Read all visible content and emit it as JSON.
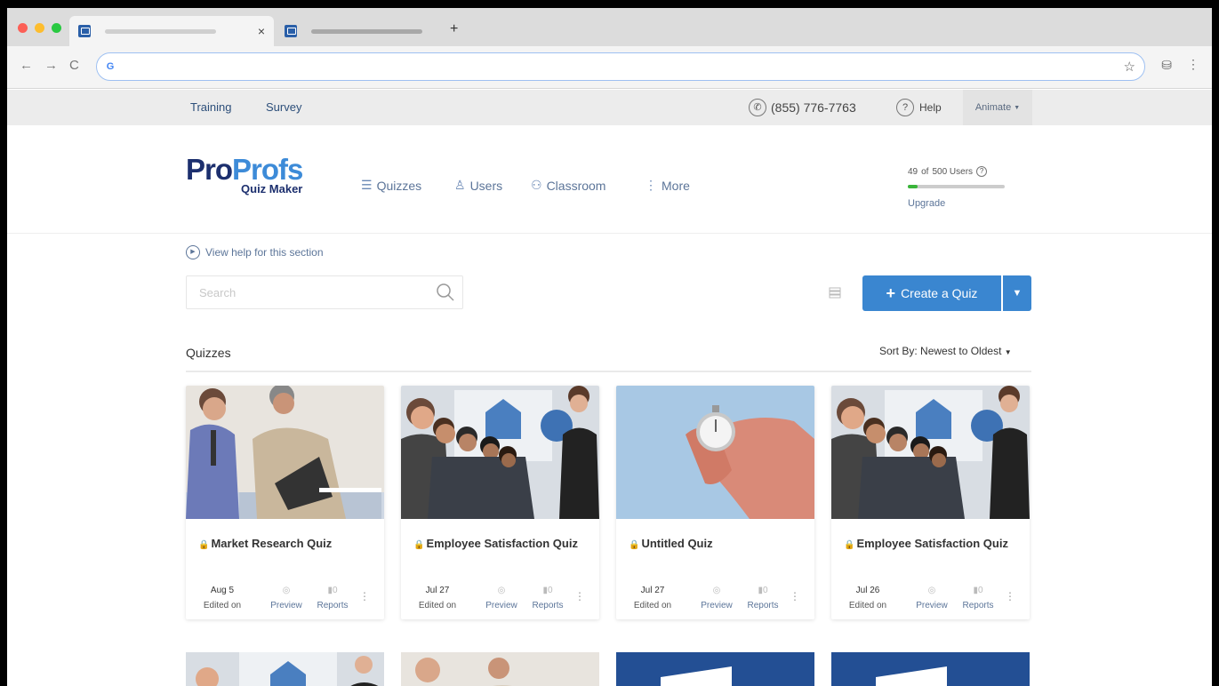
{
  "browser": {
    "new_tab_label": "+",
    "tab_close": "×",
    "address_icon": "G",
    "star_icon": "☆"
  },
  "topbar": {
    "training": "Training",
    "survey": "Survey",
    "phone": "(855) 776-7763",
    "help": "Help",
    "account": "Animate"
  },
  "header": {
    "logo_part1": "Pro",
    "logo_part2": "Profs",
    "logo_sub": "Quiz Maker",
    "nav": {
      "quizzes": "Quizzes",
      "users": "Users",
      "classroom": "Classroom",
      "more": "More"
    },
    "users_count": "49",
    "users_of": "of",
    "users_max": "500 Users",
    "users_progress_fraction": 0.098,
    "upgrade": "Upgrade"
  },
  "content": {
    "view_help": "View help for this section",
    "search_placeholder": "Search",
    "create_quiz": "Create a Quiz",
    "section_title": "Quizzes",
    "sort_by_label": "Sort By:",
    "sort_by_value": "Newest to Oldest"
  },
  "cards": [
    {
      "title": "Market Research Quiz",
      "date": "Aug 5",
      "edited_label": "Edited on",
      "preview": "Preview",
      "reports": "Reports",
      "report_count": "0"
    },
    {
      "title": "Employee Satisfaction Quiz",
      "date": "Jul 27",
      "edited_label": "Edited on",
      "preview": "Preview",
      "reports": "Reports",
      "report_count": "0"
    },
    {
      "title": "Untitled Quiz",
      "date": "Jul 27",
      "edited_label": "Edited on",
      "preview": "Preview",
      "reports": "Reports",
      "report_count": "0"
    },
    {
      "title": "Employee Satisfaction Quiz",
      "date": "Jul 26",
      "edited_label": "Edited on",
      "preview": "Preview",
      "reports": "Reports",
      "report_count": "0"
    }
  ],
  "colors": {
    "primary": "#3a86d0",
    "logo_dark": "#1c2f6e",
    "logo_light": "#3d8bd8",
    "link": "#5c7599",
    "quota_fill": "#3ab53a"
  }
}
